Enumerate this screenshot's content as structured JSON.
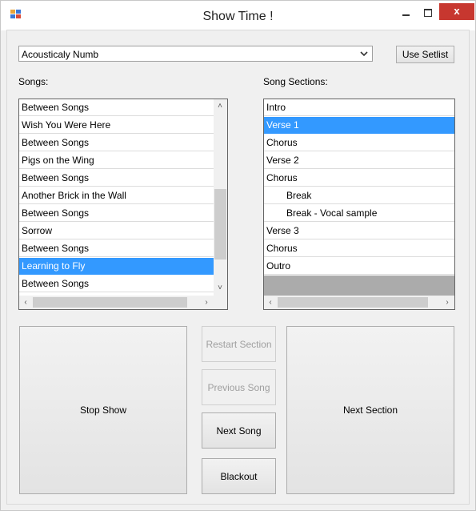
{
  "window": {
    "title": "Show Time !",
    "close_glyph": "x",
    "icon": "app-window-icon"
  },
  "setlist": {
    "selected": "Acousticaly Numb",
    "use_button": "Use Setlist"
  },
  "songs": {
    "label": "Songs:",
    "items": [
      {
        "label": "Between Songs",
        "selected": false
      },
      {
        "label": "Wish You Were Here",
        "selected": false
      },
      {
        "label": "Between Songs",
        "selected": false
      },
      {
        "label": "Pigs on the Wing",
        "selected": false
      },
      {
        "label": "Between Songs",
        "selected": false
      },
      {
        "label": "Another Brick in the Wall",
        "selected": false
      },
      {
        "label": "Between Songs",
        "selected": false
      },
      {
        "label": "Sorrow",
        "selected": false
      },
      {
        "label": "Between Songs",
        "selected": false
      },
      {
        "label": "Learning to Fly",
        "selected": true
      },
      {
        "label": "Between Songs",
        "selected": false
      }
    ]
  },
  "sections": {
    "label": "Song Sections:",
    "items": [
      {
        "label": "Intro",
        "selected": false,
        "indent": false
      },
      {
        "label": "Verse 1",
        "selected": true,
        "indent": false
      },
      {
        "label": "Chorus",
        "selected": false,
        "indent": false
      },
      {
        "label": "Verse 2",
        "selected": false,
        "indent": false
      },
      {
        "label": "Chorus",
        "selected": false,
        "indent": false
      },
      {
        "label": "Break",
        "selected": false,
        "indent": true
      },
      {
        "label": "Break - Vocal sample",
        "selected": false,
        "indent": true
      },
      {
        "label": "Verse 3",
        "selected": false,
        "indent": false
      },
      {
        "label": "Chorus",
        "selected": false,
        "indent": false
      },
      {
        "label": "Outro",
        "selected": false,
        "indent": false
      }
    ]
  },
  "controls": {
    "stop_show": "Stop Show",
    "restart_section": "Restart Section",
    "previous_song": "Previous Song",
    "next_song": "Next Song",
    "blackout": "Blackout",
    "next_section": "Next Section"
  },
  "colors": {
    "selection": "#3399ff",
    "close_button": "#c7372f"
  }
}
